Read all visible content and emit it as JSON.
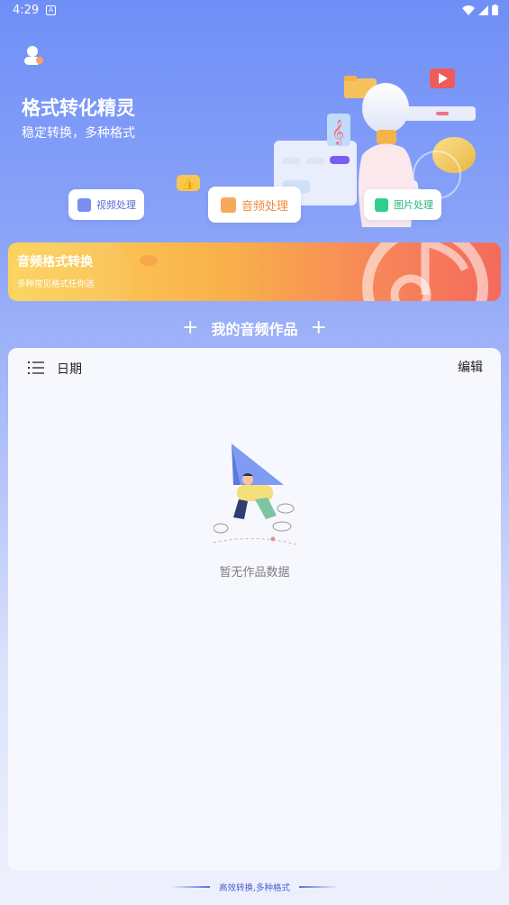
{
  "status_bar": {
    "time": "4:29",
    "notification_icon": "A"
  },
  "header": {
    "title": "格式转化精灵",
    "subtitle": "稳定转换，多种格式"
  },
  "chips": {
    "video": "视频处理",
    "audio": "音频处理",
    "image": "图片处理"
  },
  "banner": {
    "title": "音频格式转换",
    "subtitle": "多种常见格式任你选"
  },
  "section": {
    "title": "我的音频作品"
  },
  "list": {
    "sort_label": "日期",
    "edit_label": "编辑",
    "empty_text": "暂无作品数据"
  },
  "footer": {
    "text": "高效转换,多种格式"
  },
  "colors": {
    "accent": "#6f8ff7",
    "banner_start": "#fbd35b",
    "banner_end": "#f46a5c"
  }
}
